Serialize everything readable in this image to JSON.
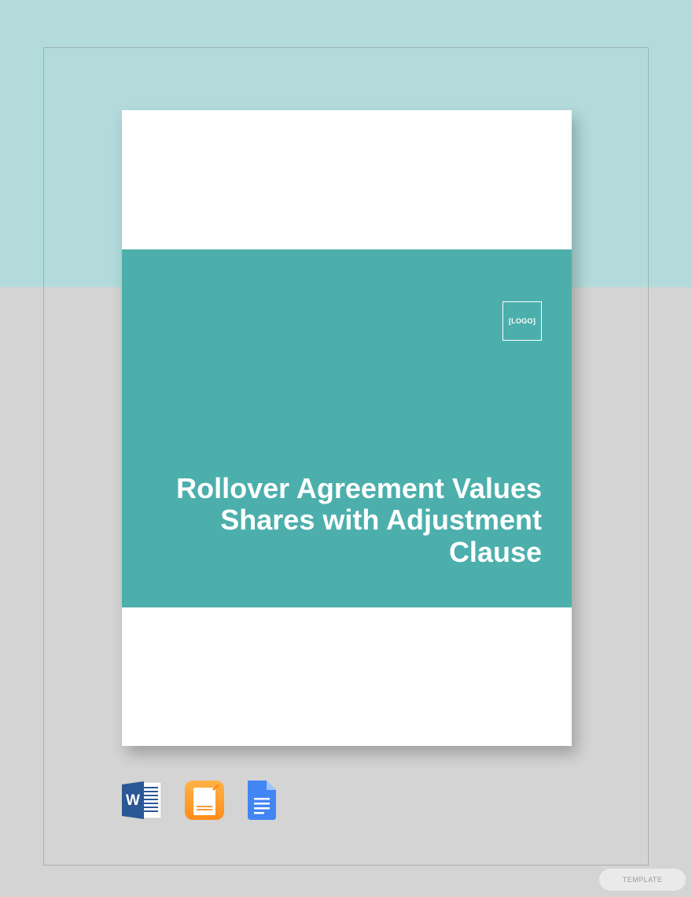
{
  "document": {
    "logo_placeholder": "[LOGO]",
    "title": "Rollover Agreement Values Shares with Adjustment Clause"
  },
  "formats": {
    "word": "word-icon",
    "pages": "pages-icon",
    "gdocs": "google-docs-icon"
  },
  "watermark": "TEMPLATE"
}
